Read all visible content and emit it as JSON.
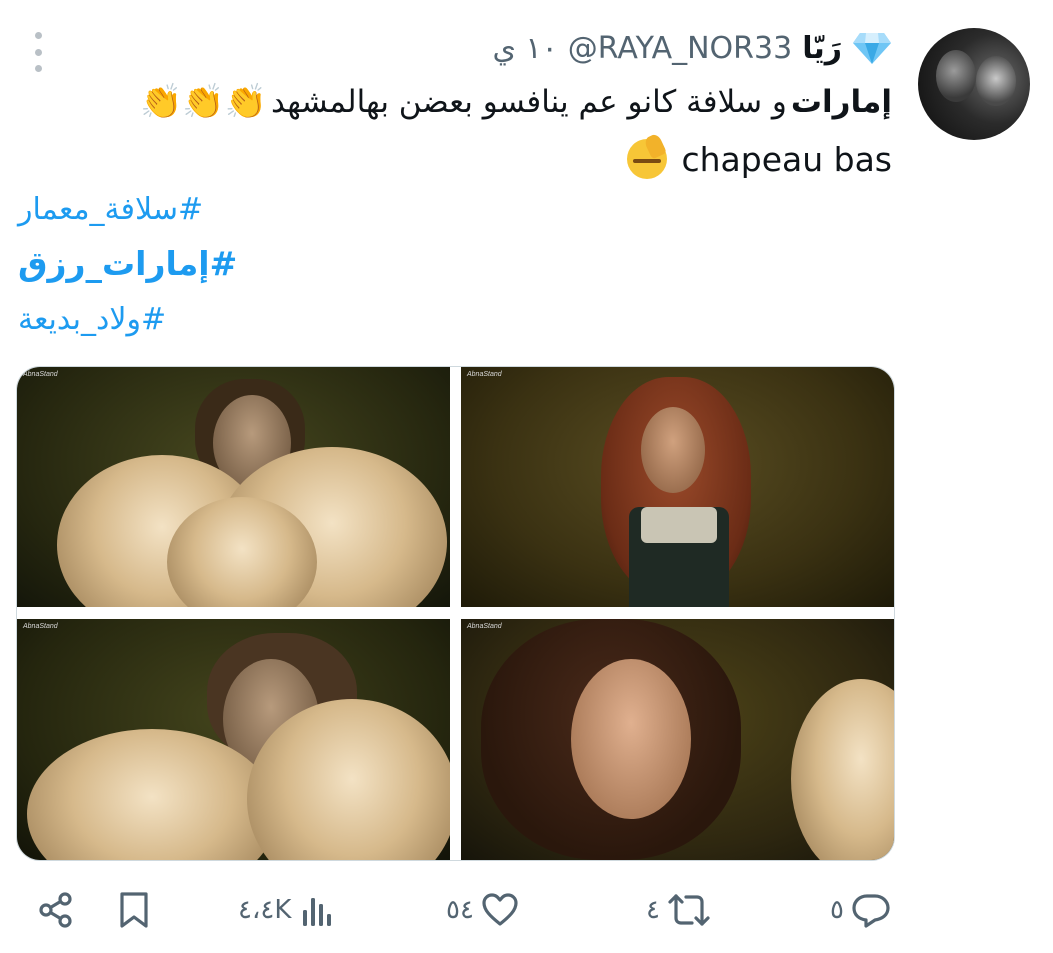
{
  "tweet": {
    "display_name": "رَيّا",
    "handle": "@RAYA_NOR33",
    "time": "١٠ ي",
    "text_bold": "إمارات",
    "text_rest": " و سلافة كانو عم ينافسو بعضن بهالمشهد ",
    "claps": "👏👏👏",
    "text_line2": "chapeau bas",
    "hashtags": [
      "#سلافة_معمار",
      "#إمارات_رزق",
      "#ولاد_بديعة"
    ],
    "media_watermark": "AbnaStand"
  },
  "actions": {
    "replies": "٥",
    "retweets": "٤",
    "likes": "٥٤",
    "views": "٤،٤K"
  },
  "colors": {
    "link": "#1d9bf0",
    "secondary_text": "#536471",
    "primary_text": "#0f1419"
  },
  "icons": [
    "more-vertical-icon",
    "diamond-icon",
    "salute-emoji-icon",
    "share-icon",
    "bookmark-icon",
    "views-icon",
    "like-icon",
    "retweet-icon",
    "reply-icon"
  ]
}
